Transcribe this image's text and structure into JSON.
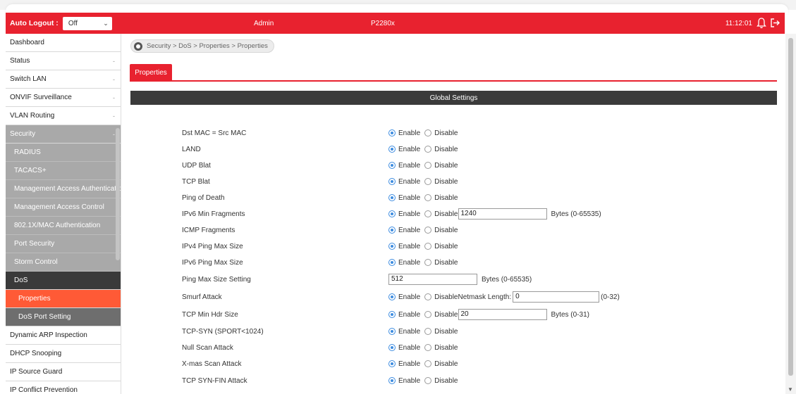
{
  "header": {
    "auto_logout_label": "Auto Logout :",
    "auto_logout_value": "Off",
    "user": "Admin",
    "model": "P2280x",
    "time": "11:12:01"
  },
  "sidebar": {
    "items": [
      {
        "label": "Dashboard",
        "toggle": ""
      },
      {
        "label": "Status",
        "toggle": "-"
      },
      {
        "label": "Switch LAN",
        "toggle": "-"
      },
      {
        "label": "ONVIF Surveillance",
        "toggle": "-"
      },
      {
        "label": "VLAN Routing",
        "toggle": "-"
      },
      {
        "label": "Security",
        "toggle": "-"
      },
      {
        "label": "RADIUS"
      },
      {
        "label": "TACACS+"
      },
      {
        "label": "Management Access Authentication"
      },
      {
        "label": "Management Access Control"
      },
      {
        "label": "802.1X/MAC Authentication"
      },
      {
        "label": "Port Security"
      },
      {
        "label": "Storm Control"
      },
      {
        "label": "DoS"
      },
      {
        "label": "Properties"
      },
      {
        "label": "DoS Port Setting"
      },
      {
        "label": "Dynamic ARP Inspection"
      },
      {
        "label": "DHCP Snooping"
      },
      {
        "label": "IP Source Guard"
      },
      {
        "label": "IP Conflict Prevention"
      }
    ]
  },
  "breadcrumb": "Security > DoS > Properties > Properties",
  "tab": "Properties",
  "section_title": "Global Settings",
  "options": {
    "enable": "Enable",
    "disable": "Disable"
  },
  "rows": [
    {
      "label": "Dst MAC = Src MAC",
      "selected": "enable"
    },
    {
      "label": "LAND",
      "selected": "enable"
    },
    {
      "label": "UDP Blat",
      "selected": "enable"
    },
    {
      "label": "TCP Blat",
      "selected": "enable"
    },
    {
      "label": "Ping of Death",
      "selected": "enable"
    },
    {
      "label": "IPv6 Min Fragments",
      "selected": "enable",
      "field_value": "1240",
      "range": "Bytes (0-65535)"
    },
    {
      "label": "ICMP Fragments",
      "selected": "enable"
    },
    {
      "label": "IPv4 Ping Max Size",
      "selected": "enable"
    },
    {
      "label": "IPv6 Ping Max Size",
      "selected": "enable"
    },
    {
      "label": "Ping Max Size Setting",
      "field_value": "512",
      "range": "Bytes (0-65535)"
    },
    {
      "label": "Smurf Attack",
      "selected": "enable",
      "extra_label": "Netmask Length:",
      "field_value": "0",
      "range": "(0-32)"
    },
    {
      "label": "TCP Min Hdr Size",
      "selected": "enable",
      "field_value": "20",
      "range": "Bytes (0-31)"
    },
    {
      "label": "TCP-SYN (SPORT<1024)",
      "selected": "enable"
    },
    {
      "label": "Null Scan Attack",
      "selected": "enable"
    },
    {
      "label": "X-mas Scan Attack",
      "selected": "enable"
    },
    {
      "label": "TCP SYN-FIN Attack",
      "selected": "enable"
    }
  ]
}
